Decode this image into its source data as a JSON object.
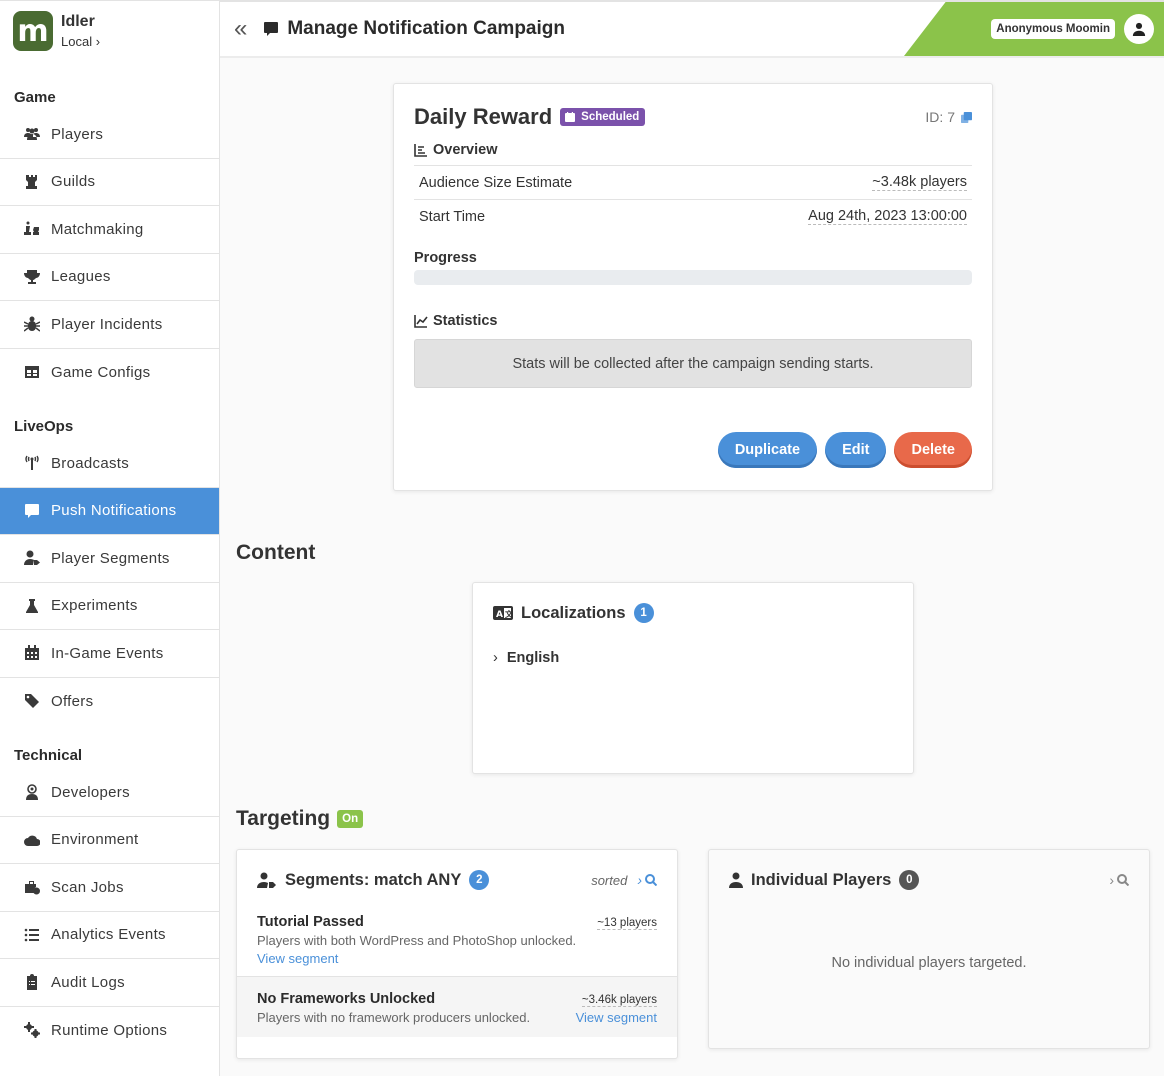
{
  "app": {
    "name": "Idler",
    "environment": "Local"
  },
  "header": {
    "title": "Manage Notification Campaign",
    "user": "Anonymous Moomin"
  },
  "sidebar": {
    "sections": [
      {
        "title": "Game",
        "items": [
          {
            "label": "Players",
            "icon": "users-icon"
          },
          {
            "label": "Guilds",
            "icon": "chess-rook-icon"
          },
          {
            "label": "Matchmaking",
            "icon": "chess-icon"
          },
          {
            "label": "Leagues",
            "icon": "trophy-icon"
          },
          {
            "label": "Player Incidents",
            "icon": "bug-icon"
          },
          {
            "label": "Game Configs",
            "icon": "table-icon"
          }
        ]
      },
      {
        "title": "LiveOps",
        "items": [
          {
            "label": "Broadcasts",
            "icon": "broadcast-tower-icon"
          },
          {
            "label": "Push Notifications",
            "icon": "comment-icon",
            "active": true
          },
          {
            "label": "Player Segments",
            "icon": "user-tag-icon"
          },
          {
            "label": "Experiments",
            "icon": "flask-icon"
          },
          {
            "label": "In-Game Events",
            "icon": "calendar-icon"
          },
          {
            "label": "Offers",
            "icon": "tags-icon"
          }
        ]
      },
      {
        "title": "Technical",
        "items": [
          {
            "label": "Developers",
            "icon": "user-astronaut-icon"
          },
          {
            "label": "Environment",
            "icon": "cloud-icon"
          },
          {
            "label": "Scan Jobs",
            "icon": "business-time-icon"
          },
          {
            "label": "Analytics Events",
            "icon": "list-icon"
          },
          {
            "label": "Audit Logs",
            "icon": "clipboard-list-icon"
          },
          {
            "label": "Runtime Options",
            "icon": "cogs-icon"
          }
        ]
      }
    ]
  },
  "campaign": {
    "name": "Daily Reward",
    "status": "Scheduled",
    "status_color": "#7b52ab",
    "id_label": "ID: 7",
    "overview_title": "Overview",
    "rows": [
      {
        "label": "Audience Size Estimate",
        "value": "~3.48k players"
      },
      {
        "label": "Start Time",
        "value": "Aug 24th, 2023 13:00:00"
      }
    ],
    "progress_label": "Progress",
    "progress_percent": 0,
    "statistics_title": "Statistics",
    "statistics_message": "Stats will be collected after the campaign sending starts.",
    "buttons": {
      "duplicate": "Duplicate",
      "edit": "Edit",
      "delete": "Delete"
    }
  },
  "content": {
    "heading": "Content",
    "localizations_title": "Localizations",
    "localizations_count": "1",
    "languages": [
      "English"
    ]
  },
  "targeting": {
    "heading": "Targeting",
    "status_badge": "On",
    "segments": {
      "title": "Segments: match ANY",
      "count": "2",
      "sorted_label": "sorted",
      "items": [
        {
          "name": "Tutorial Passed",
          "count": "~13 players",
          "description": "Players with both WordPress and PhotoShop unlocked.",
          "link": "View segment"
        },
        {
          "name": "No Frameworks Unlocked",
          "count": "~3.46k players",
          "description": "Players with no framework producers unlocked.",
          "link": "View segment"
        }
      ]
    },
    "individual": {
      "title": "Individual Players",
      "count": "0",
      "empty_message": "No individual players targeted."
    }
  }
}
